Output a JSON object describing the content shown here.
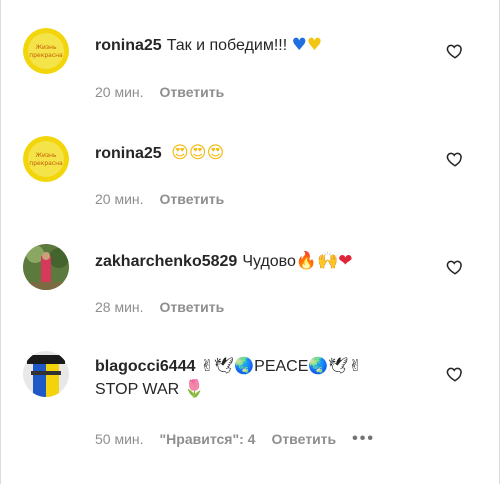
{
  "comments": [
    {
      "username": "ronina25",
      "text": "Так и победим!!!",
      "emoji": "💙💛",
      "time": "20 мин.",
      "reply": "Ответить",
      "avatar_text": "Жизнь прекрасна",
      "avatar_color": "#f2d60b"
    },
    {
      "username": "ronina25",
      "text": "",
      "emoji": "😍😍😍",
      "time": "20 мин.",
      "reply": "Ответить",
      "avatar_text": "Жизнь прекрасна",
      "avatar_color": "#f2d60b"
    },
    {
      "username": "zakharchenko5829",
      "text": "Чудово",
      "emoji": "🔥🙌❤",
      "time": "28 мин.",
      "reply": "Ответить",
      "avatar_color": "#6f8a4e"
    },
    {
      "username": "blagocci6444",
      "text_line1": "✌🕊🌏PEACE🌏🕊✌",
      "text_line2": "STOP WAR",
      "emoji_line2": "🌷",
      "time": "50 мин.",
      "likes": "\"Нравится\": 4",
      "reply": "Ответить",
      "more": "•••",
      "avatar_color": "#1e57c6"
    }
  ],
  "icons": {
    "like": "heart-outline-icon",
    "more": "more-horizontal-icon"
  }
}
